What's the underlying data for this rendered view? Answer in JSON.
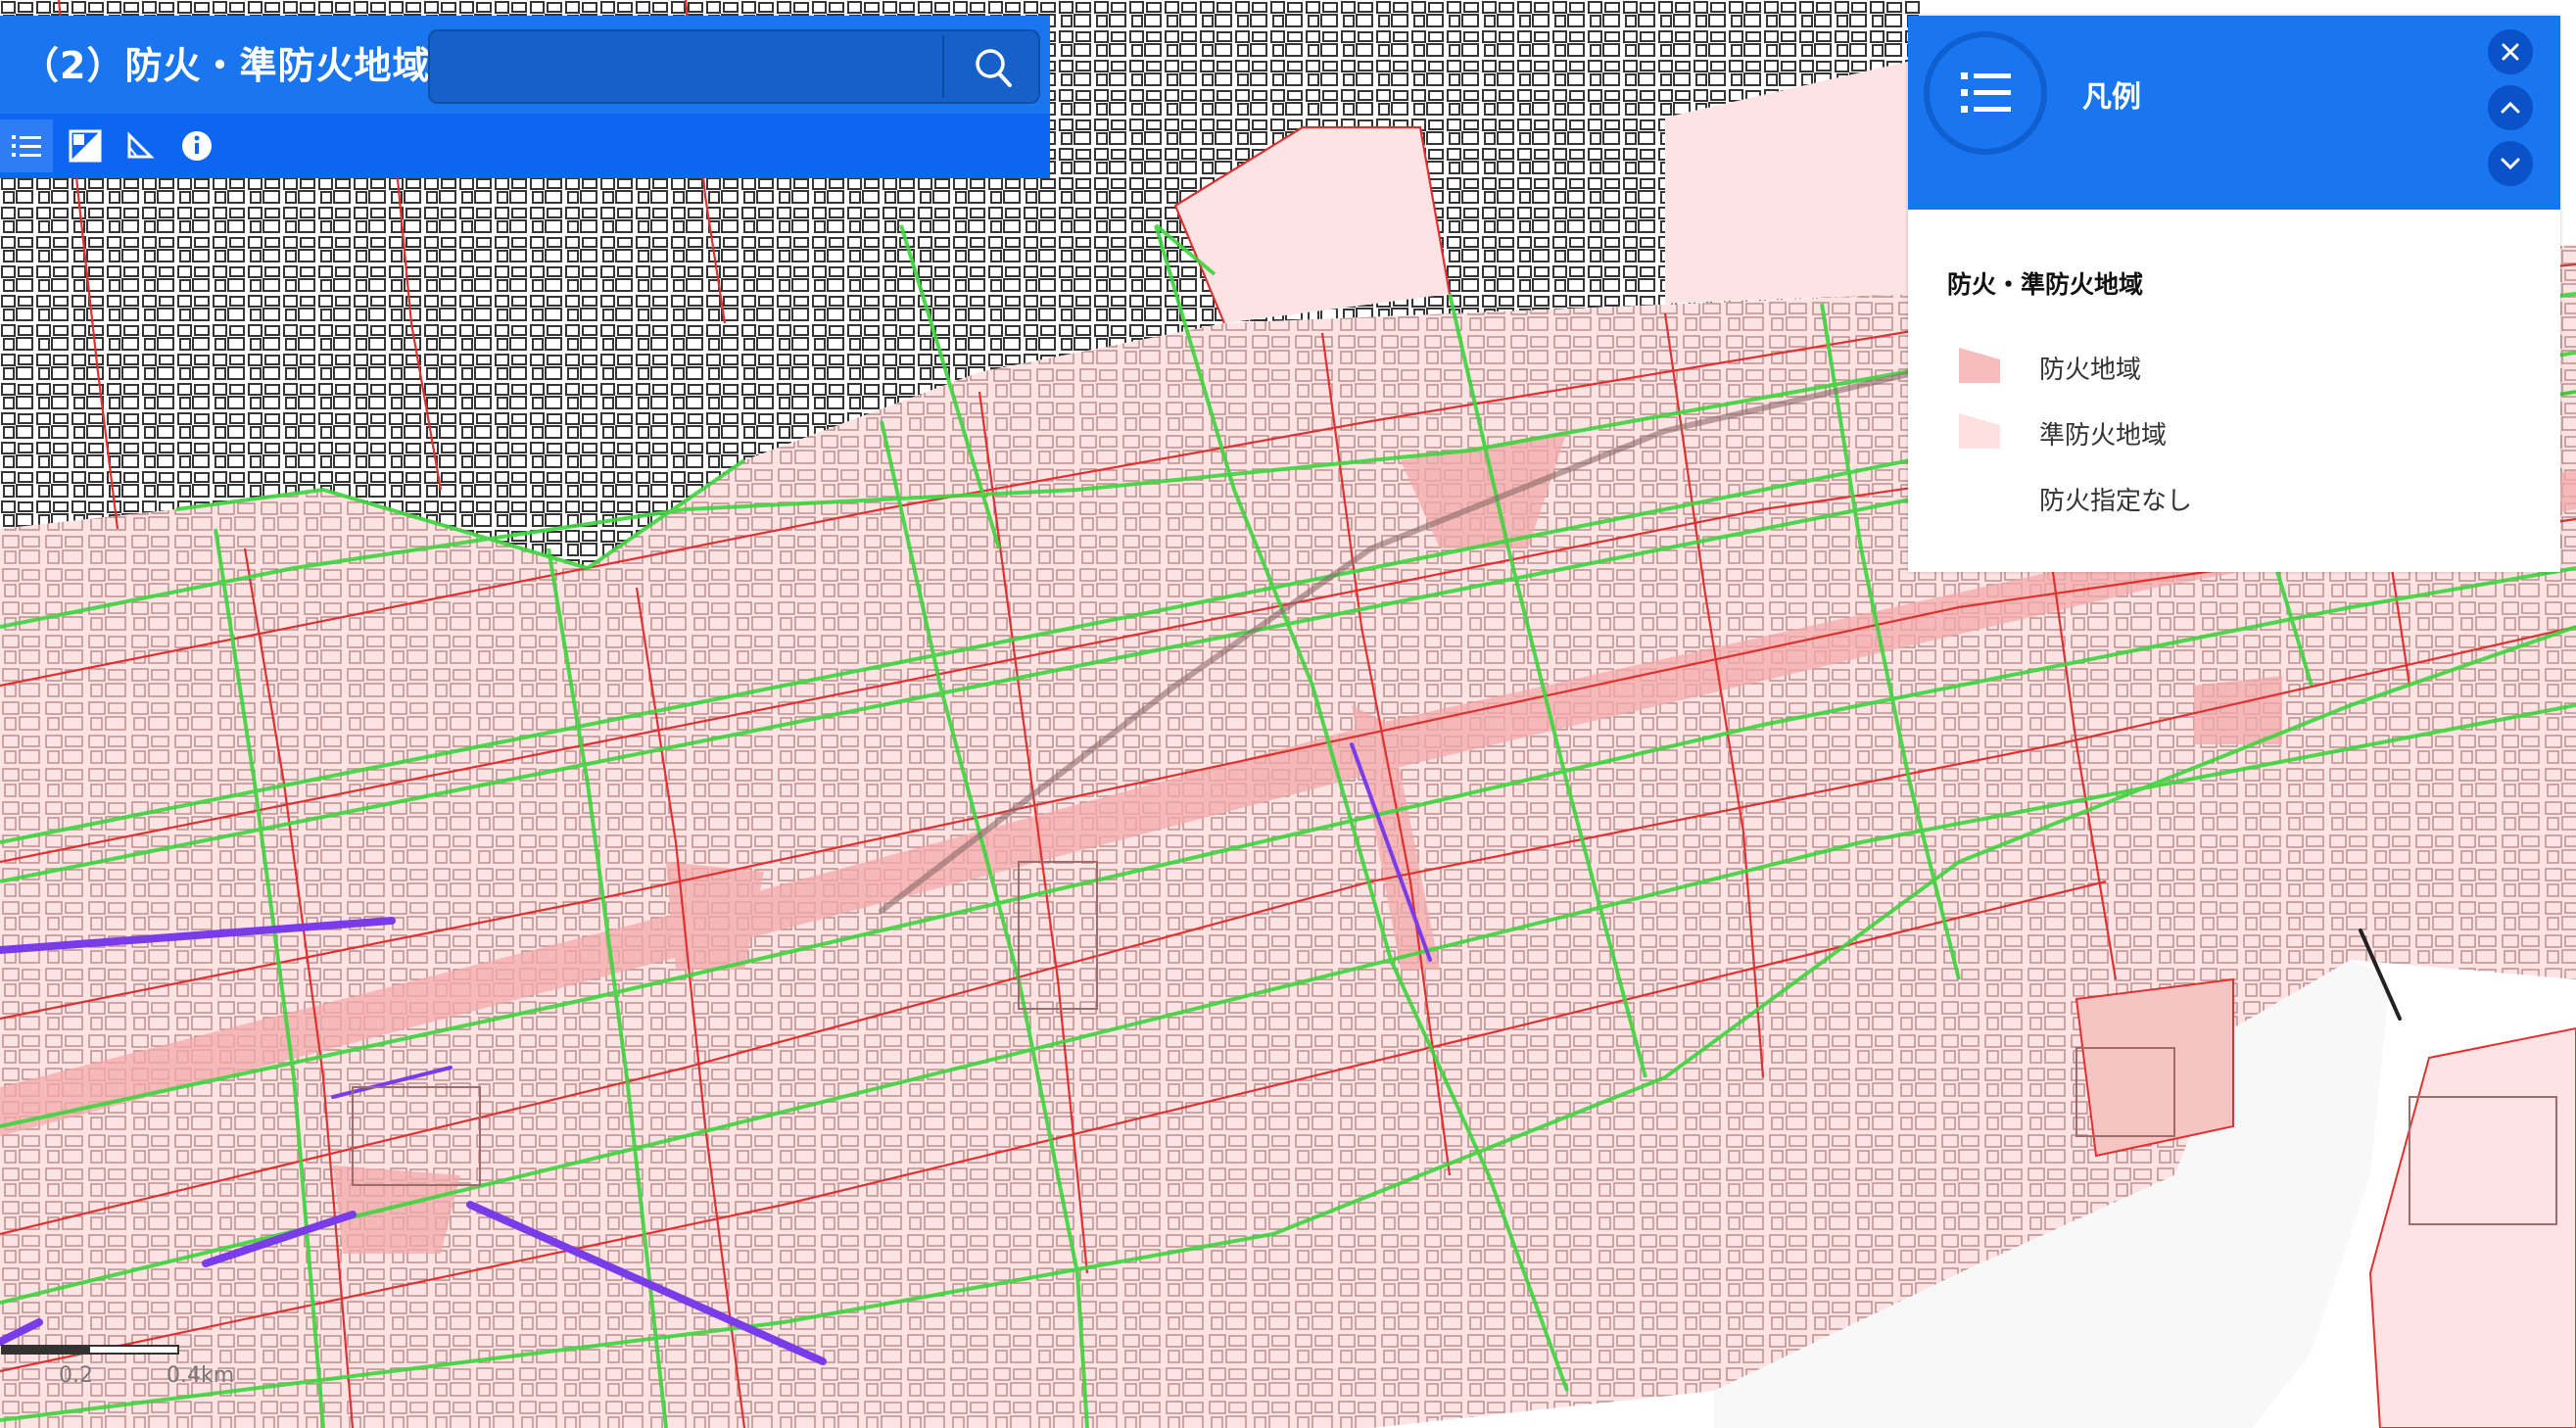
{
  "header": {
    "title": "（2）防火・準防火地域",
    "search_value": "",
    "search_placeholder": ""
  },
  "toolbar": {
    "items": [
      "list-icon",
      "layers-icon",
      "measure-icon",
      "info-icon"
    ]
  },
  "legend": {
    "title": "凡例",
    "section_title": "防火・準防火地域",
    "items": [
      {
        "label": "防火地域",
        "color": "#f7bcbc"
      },
      {
        "label": "準防火地域",
        "color": "#fde0e0"
      },
      {
        "label": "防火指定なし",
        "color": "#ffffff"
      }
    ]
  },
  "scale": {
    "labels": [
      "0.2",
      "0.4km"
    ]
  },
  "colors": {
    "header_blue": "#1a75f0",
    "toolbar_blue": "#0d66f2",
    "fire_zone": "#f7c4c4",
    "quasi_fire_zone": "#fde3e3",
    "road_green": "#3fd43f",
    "boundary_red": "#e03030",
    "rail_purple": "#7a3ce8"
  }
}
